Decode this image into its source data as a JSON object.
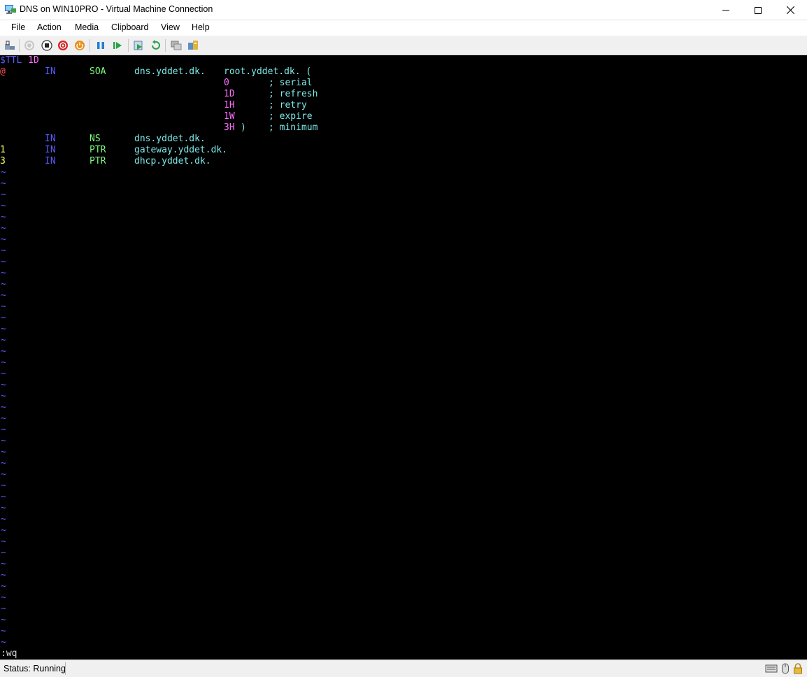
{
  "window": {
    "title": "DNS on WIN10PRO - Virtual Machine Connection",
    "controls": {
      "minimize": "—",
      "maximize": "☐",
      "close": "✕"
    }
  },
  "menu": [
    "File",
    "Action",
    "Media",
    "Clipboard",
    "View",
    "Help"
  ],
  "toolbar": {
    "buttons": [
      "ctrl-alt-del-icon",
      "start-icon",
      "turn-off-icon",
      "shut-down-icon",
      "save-state-icon",
      "pause-icon",
      "resume-icon",
      "checkpoint-icon",
      "revert-icon",
      "enhanced-session-icon",
      "share-icon"
    ]
  },
  "colors": {
    "keyword": "#5a5aff",
    "record_type": "#7cfc7c",
    "value": "#7ee8e8",
    "number": "#ff6fff",
    "label": "#ffff66",
    "at": "#ff5555"
  },
  "terminal": {
    "lines": [
      [
        {
          "t": "$TTL",
          "c": "keyword",
          "col": 0
        },
        {
          "t": "1D",
          "c": "number",
          "col": 5
        }
      ],
      [
        {
          "t": "@",
          "c": "at",
          "col": 0
        },
        {
          "t": "IN",
          "c": "keyword",
          "col": 8
        },
        {
          "t": "SOA",
          "c": "record_type",
          "col": 16
        },
        {
          "t": "dns.yddet.dk.",
          "c": "value",
          "col": 24
        },
        {
          "t": "root.yddet.dk. (",
          "c": "value",
          "col": 40
        }
      ],
      [
        {
          "t": "0",
          "c": "number",
          "col": 40
        },
        {
          "t": "; serial",
          "c": "value",
          "col": 48
        }
      ],
      [
        {
          "t": "1D",
          "c": "number",
          "col": 40
        },
        {
          "t": "; refresh",
          "c": "value",
          "col": 48
        }
      ],
      [
        {
          "t": "1H",
          "c": "number",
          "col": 40
        },
        {
          "t": "; retry",
          "c": "value",
          "col": 48
        }
      ],
      [
        {
          "t": "1W",
          "c": "number",
          "col": 40
        },
        {
          "t": "; expire",
          "c": "value",
          "col": 48
        }
      ],
      [
        {
          "t": "3H",
          "c": "number",
          "col": 40
        },
        {
          "t": ")",
          "c": "value",
          "col": 43
        },
        {
          "t": "; minimum",
          "c": "value",
          "col": 48
        }
      ],
      [
        {
          "t": "IN",
          "c": "keyword",
          "col": 8
        },
        {
          "t": "NS",
          "c": "record_type",
          "col": 16
        },
        {
          "t": "dns.yddet.dk.",
          "c": "value",
          "col": 24
        }
      ],
      [
        {
          "t": "1",
          "c": "label",
          "col": 0
        },
        {
          "t": "IN",
          "c": "keyword",
          "col": 8
        },
        {
          "t": "PTR",
          "c": "record_type",
          "col": 16
        },
        {
          "t": "gateway.yddet.dk.",
          "c": "value",
          "col": 24
        }
      ],
      [
        {
          "t": "3",
          "c": "label",
          "col": 0
        },
        {
          "t": "IN",
          "c": "keyword",
          "col": 8
        },
        {
          "t": "PTR",
          "c": "record_type",
          "col": 16
        },
        {
          "t": "dhcp.yddet.dk.",
          "c": "value",
          "col": 24
        }
      ]
    ],
    "empty_line_marker": "~",
    "command": ":wq"
  },
  "status": {
    "text": "Status: Running"
  }
}
